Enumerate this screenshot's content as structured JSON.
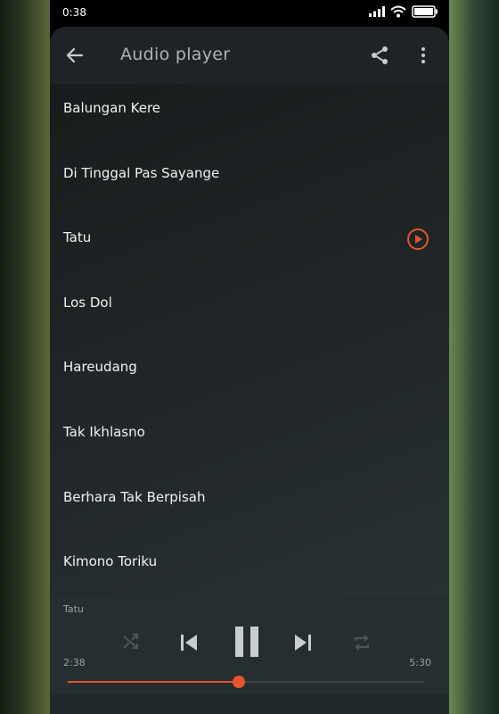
{
  "status_bar": {
    "time": "0:38",
    "icons": [
      "signal-icon",
      "wifi-icon",
      "battery-icon"
    ]
  },
  "app_bar": {
    "title": "Audio player",
    "icons": [
      "back-arrow-icon",
      "share-icon",
      "more-vert-icon"
    ]
  },
  "songs": [
    {
      "title": "Balungan Kere",
      "playing": false
    },
    {
      "title": "Di Tinggal Pas Sayange",
      "playing": false
    },
    {
      "title": "Tatu",
      "playing": true
    },
    {
      "title": "Los Dol",
      "playing": false
    },
    {
      "title": "Hareudang",
      "playing": false
    },
    {
      "title": "Tak Ikhlasno",
      "playing": false
    },
    {
      "title": "Berhara Tak Berpisah",
      "playing": false
    },
    {
      "title": "Kimono Toriku",
      "playing": false
    }
  ],
  "player": {
    "now_playing": "Tatu",
    "current_time": "2:38",
    "duration": "5:30",
    "progress_fraction": 0.479,
    "controls": [
      "shuffle-icon",
      "skip-previous-icon",
      "pause-icon",
      "skip-next-icon",
      "repeat-icon"
    ]
  },
  "colors": {
    "accent": "#e5552e",
    "text": "#f2f2f2",
    "muted": "#9aa1a2"
  }
}
